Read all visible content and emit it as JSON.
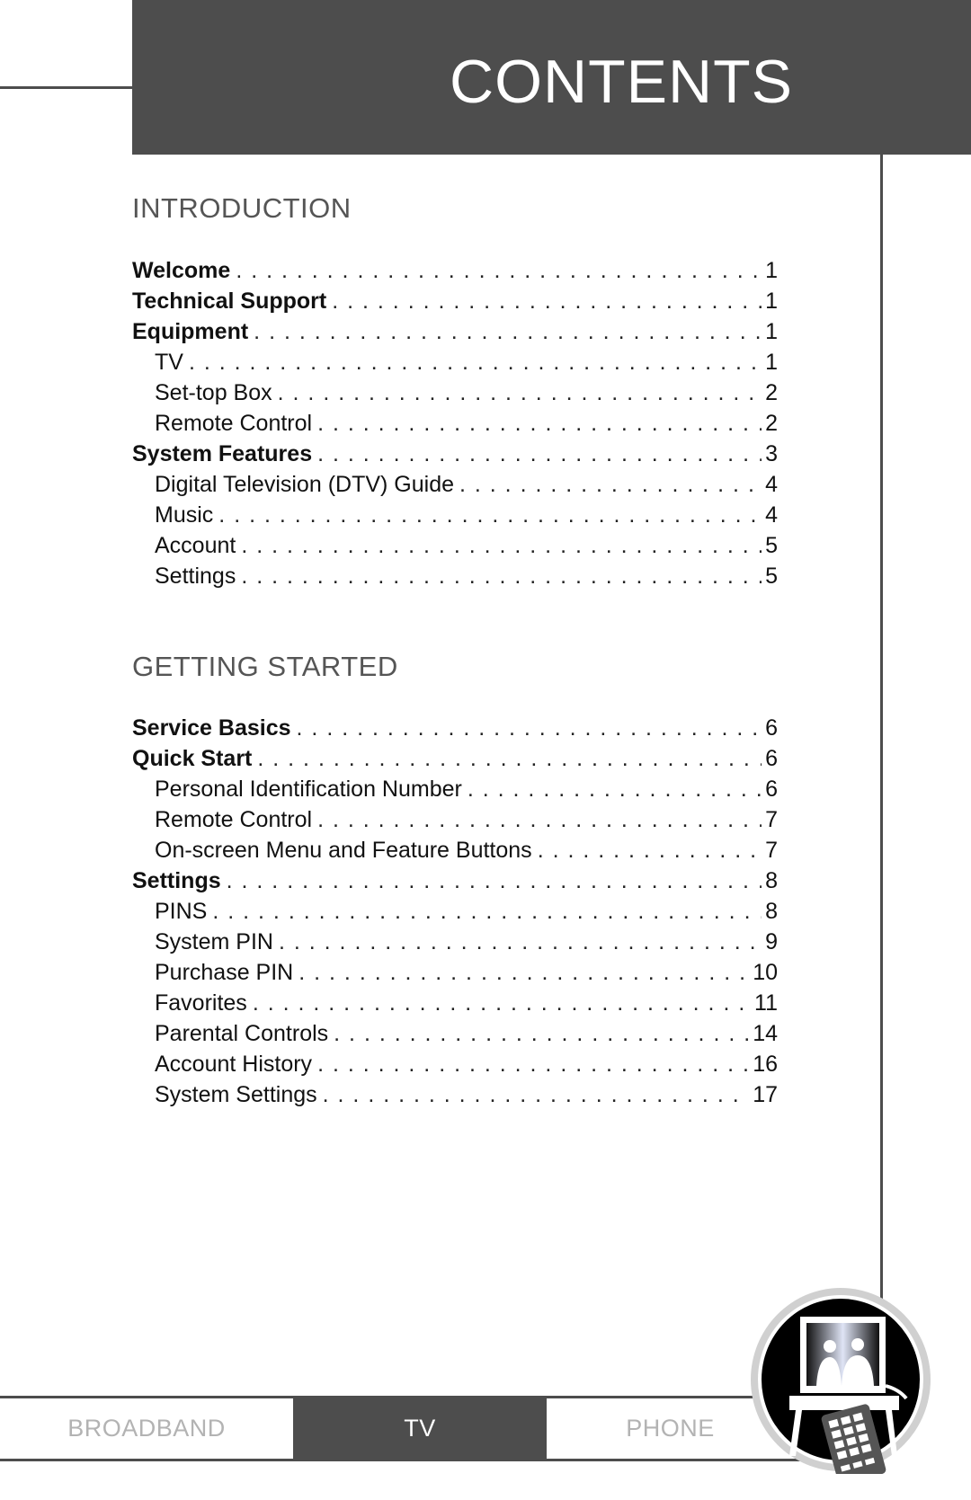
{
  "header": {
    "title": "CONTENTS"
  },
  "sections": [
    {
      "title": "INTRODUCTION",
      "entries": [
        {
          "label": "Welcome",
          "page": "1",
          "level": 1
        },
        {
          "label": "Technical Support",
          "page": "1",
          "level": 1
        },
        {
          "label": "Equipment",
          "page": "1",
          "level": 1
        },
        {
          "label": "TV",
          "page": "1",
          "level": 2
        },
        {
          "label": "Set-top Box",
          "page": "2",
          "level": 2
        },
        {
          "label": "Remote Control",
          "page": "2",
          "level": 2
        },
        {
          "label": "System Features",
          "page": "3",
          "level": 1
        },
        {
          "label": "Digital Television (DTV) Guide",
          "page": "4",
          "level": 2
        },
        {
          "label": "Music",
          "page": "4",
          "level": 2
        },
        {
          "label": "Account",
          "page": "5",
          "level": 2
        },
        {
          "label": "Settings",
          "page": "5",
          "level": 2
        }
      ]
    },
    {
      "title": "GETTING STARTED",
      "entries": [
        {
          "label": "Service Basics",
          "page": "6",
          "level": 1
        },
        {
          "label": "Quick Start",
          "page": "6",
          "level": 1
        },
        {
          "label": "Personal Identification Number",
          "page": "6",
          "level": 2
        },
        {
          "label": "Remote Control",
          "page": "7",
          "level": 2
        },
        {
          "label": "On-screen Menu and Feature Buttons",
          "page": "7",
          "level": 2
        },
        {
          "label": "Settings",
          "page": "8",
          "level": 1
        },
        {
          "label": "PINS",
          "page": "8",
          "level": 2
        },
        {
          "label": "System PIN",
          "page": "9",
          "level": 2
        },
        {
          "label": "Purchase PIN",
          "page": "10",
          "level": 2
        },
        {
          "label": "Favorites",
          "page": "11",
          "level": 2
        },
        {
          "label": "Parental Controls",
          "page": "14",
          "level": 2
        },
        {
          "label": "Account History",
          "page": "16",
          "level": 2
        },
        {
          "label": "System Settings",
          "page": "17",
          "level": 2
        }
      ]
    }
  ],
  "footer": {
    "tabs": [
      {
        "label": "BROADBAND",
        "active": false
      },
      {
        "label": "TV",
        "active": true
      },
      {
        "label": "PHONE",
        "active": false
      }
    ],
    "badge_icon": "tv-remote-icon"
  },
  "colors": {
    "dark_gray": "#4d4d4d",
    "tab_inactive_text": "#b3b3b3",
    "section_title": "#555555"
  }
}
